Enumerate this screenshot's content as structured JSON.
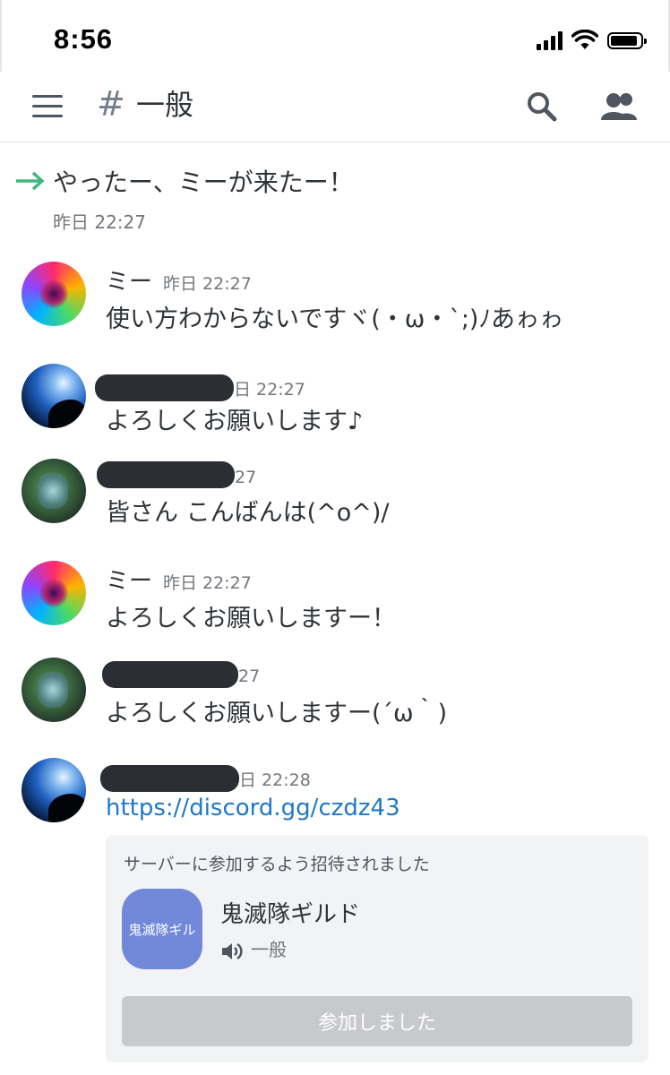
{
  "status_bar": {
    "time": "8:56"
  },
  "header": {
    "hash_symbol": "#",
    "channel_name": "一般"
  },
  "system_message": {
    "text": "やったー、ミーが来たー！",
    "time": "昨日 22:27"
  },
  "messages": [
    {
      "author": "ミー",
      "time": "昨日 22:27",
      "text": "使い方わからないですヾ(・ω・`;)ﾉあゎゎ",
      "avatar": "rainbow-rose"
    },
    {
      "author": "",
      "time_partial": "日 22:27",
      "text": "よろしくお願いします♪",
      "avatar": "moon-night"
    },
    {
      "author": "",
      "time_partial": "27",
      "text": "皆さん こんばんは(^o^)/",
      "avatar": "forest"
    },
    {
      "author": "ミー",
      "time": "昨日 22:27",
      "text": "よろしくお願いしますー！",
      "avatar": "rainbow-rose"
    },
    {
      "author": "",
      "time_partial": "27",
      "text": "よろしくお願いしますー(´ω｀)",
      "avatar": "forest"
    },
    {
      "author": "",
      "time_partial": "日 22:28",
      "link": "https://discord.gg/czdz43",
      "avatar": "moon-night"
    }
  ],
  "invite": {
    "heading": "サーバーに参加するよう招待されました",
    "guild_icon_text": "鬼滅隊ギル",
    "guild_name": "鬼滅隊ギルド",
    "channel": "一般",
    "button_label": "参加しました"
  },
  "colors": {
    "accent": "#7289da",
    "link": "#1f78c8",
    "system_arrow": "#43b581",
    "button_disabled": "#c7c9cc"
  }
}
